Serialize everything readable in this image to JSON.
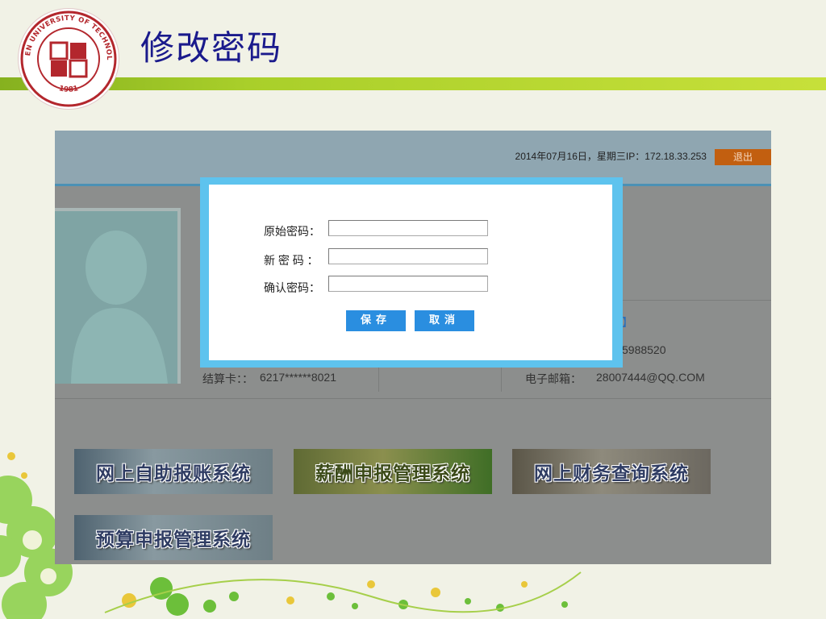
{
  "slide": {
    "title": "修改密码",
    "logo": {
      "text_top": "XIAMEN UNIVERSITY OF TECHNOLOGY",
      "year": "1981",
      "name": "logo"
    }
  },
  "app": {
    "date_ip": "2014年07月16日，星期三IP：172.18.33.253",
    "logout_label": "退出",
    "settlement_label": "结算卡：：",
    "settlement_value": "6217******8021",
    "phone_partial": "5988520",
    "email_label": "电子邮箱：",
    "email_value": "28007444@QQ.COM",
    "link_partial": "】"
  },
  "modal": {
    "original_label": "原始密码：",
    "new_label": "新 密 码 ：",
    "confirm_label": "确认密码：",
    "original_value": "",
    "new_value": "",
    "confirm_value": "",
    "save_label": "保存",
    "cancel_label": "取消"
  },
  "systems": [
    {
      "label": "网上自助报账系统"
    },
    {
      "label": "薪酬申报管理系统"
    },
    {
      "label": "网上财务查询系统"
    },
    {
      "label": "预算申报管理系统"
    }
  ],
  "colors": {
    "title": "#1a1a8c",
    "green_bar": "#a9cf2a",
    "modal_border": "#5ec3ee",
    "button": "#2a8ee0",
    "logout": "#c25f10"
  }
}
